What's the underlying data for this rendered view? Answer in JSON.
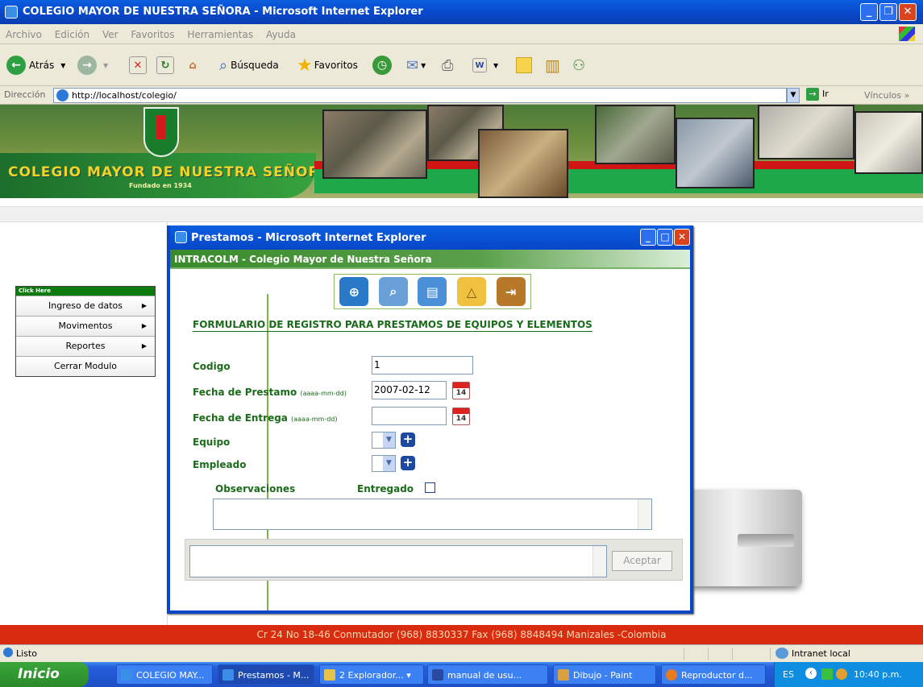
{
  "window": {
    "title": "COLEGIO MAYOR DE NUESTRA SEÑORA - Microsoft Internet Explorer"
  },
  "menubar": [
    "Archivo",
    "Edición",
    "Ver",
    "Favoritos",
    "Herramientas",
    "Ayuda"
  ],
  "toolbar": {
    "back": "Atrás",
    "search": "Búsqueda",
    "favorites": "Favoritos"
  },
  "address": {
    "label": "Dirección",
    "url": "http://localhost/colegio/",
    "go": "Ir",
    "links": "Vínculos"
  },
  "banner": {
    "school": "COLEGIO MAYOR DE NUESTRA SEÑORA",
    "founded": "Fundado en 1934"
  },
  "sidemenu": {
    "header": "Click Here",
    "items": [
      "Ingreso de datos",
      "Movimentos",
      "Reportes",
      "Cerrar Modulo"
    ]
  },
  "popup": {
    "title": "Prestamos - Microsoft Internet Explorer",
    "header": "INTRACOLM - Colegio Mayor de Nuestra Señora",
    "form_title": "FORMULARIO DE REGISTRO PARA PRESTAMOS DE EQUIPOS Y ELEMENTOS",
    "codigo_label": "Codigo",
    "codigo_value": "1",
    "fecha_prestamo_label": "Fecha de Prestamo",
    "fecha_prestamo_hint": "(aaaa-mm-dd)",
    "fecha_prestamo_value": "2007-02-12",
    "fecha_entrega_label": "Fecha de Entrega",
    "fecha_entrega_hint": "(aaaa-mm-dd)",
    "fecha_entrega_value": "",
    "calendar_day": "14",
    "equipo_label": "Equipo",
    "empleado_label": "Empleado",
    "observaciones_label": "Observaciones",
    "entregado_label": "Entregado",
    "accept": "Aceptar"
  },
  "footer": "Cr 24 No 18-46 Conmutador (968) 8830337 Fax (968) 8848494 Manizales -Colombia",
  "status": {
    "left": "Listo",
    "zone": "Intranet local"
  },
  "taskbar": {
    "start": "Inicio",
    "tasks": [
      "COLEGIO MAY...",
      "Prestamos - M...",
      "2 Explorador...",
      "manual de usu...",
      "Dibujo - Paint",
      "Reproductor d..."
    ],
    "lang": "ES",
    "time": "10:40 p.m."
  }
}
